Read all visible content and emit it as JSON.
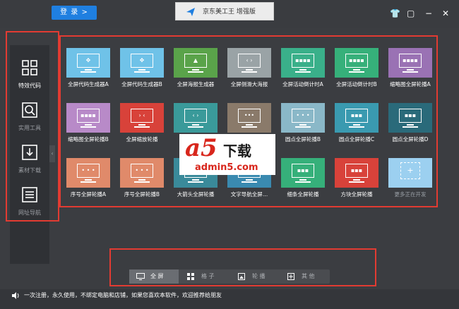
{
  "header": {
    "login_label": "登 录 >",
    "app_title": "京东美工王 增强版",
    "controls": {
      "shirt": "👕",
      "maximize": "▢",
      "minimize": "−",
      "close": "✕"
    },
    "brand_color": "#1f7fe0"
  },
  "sidebar": {
    "collapse_glyph": "‹",
    "items": [
      {
        "label": "特效代码",
        "icon": "grid-icon"
      },
      {
        "label": "实用工具",
        "icon": "search-icon"
      },
      {
        "label": "素材下载",
        "icon": "download-icon"
      },
      {
        "label": "网址导航",
        "icon": "list-icon"
      }
    ]
  },
  "tiles": [
    {
      "label": "全屏代码生成器A",
      "color": "#6fc2e8",
      "glyph": "✥"
    },
    {
      "label": "全屏代码生成器B",
      "color": "#6fc2e8",
      "glyph": "✥"
    },
    {
      "label": "全屏海报生成器",
      "color": "#5aa34a",
      "glyph": "▲"
    },
    {
      "label": "全屏侧滑大海报",
      "color": "#9aa3a6",
      "glyph": "‹ ›"
    },
    {
      "label": "全屏活动倒计时A",
      "color": "#3ab08a",
      "glyph": "▪▪▪▪"
    },
    {
      "label": "全屏活动倒计时B",
      "color": "#36b07a",
      "glyph": "▪▪▪▪"
    },
    {
      "label": "缩略图全屏轮播A",
      "color": "#9a72b4",
      "glyph": "▪▪▪▪"
    },
    {
      "label": "缩略图全屏轮播B",
      "color": "#b88ac8",
      "glyph": "▪▪▪▪"
    },
    {
      "label": "全屏缩放轮播",
      "color": "#d8423a",
      "glyph": "› ‹"
    },
    {
      "label": "普通全屏轮播",
      "color": "#3a9a9a",
      "glyph": "‹ ›"
    },
    {
      "label": "大图全屏轮播",
      "color": "#8a7a6a",
      "glyph": "•••"
    },
    {
      "label": "圆点全屏轮播B",
      "color": "#8ab8c8",
      "glyph": "• • •"
    },
    {
      "label": "圆点全屏轮播C",
      "color": "#3a9ab0",
      "glyph": "▪▪▪"
    },
    {
      "label": "圆点全屏轮播D",
      "color": "#2a6a7a",
      "glyph": "▪▪▪"
    },
    {
      "label": "序号全屏轮播A",
      "color": "#e08a6a",
      "glyph": "• • •"
    },
    {
      "label": "序号全屏轮播B",
      "color": "#e08a6a",
      "glyph": "• • •"
    },
    {
      "label": "大箭头全屏轮播",
      "color": "#3a8a9a",
      "glyph": "‹ ›"
    },
    {
      "label": "文字导航全屏…",
      "color": "#3a8ab0",
      "glyph": "▪▪▪"
    },
    {
      "label": "细条全屏轮播",
      "color": "#36b07a",
      "glyph": "▪▪▪"
    },
    {
      "label": "方块全屏轮播",
      "color": "#d8423a",
      "glyph": "▪▪▪"
    },
    {
      "label": "更多正在开发",
      "color": "#9cd0f0",
      "glyph": "+"
    }
  ],
  "tabs": [
    {
      "label": "全 屏",
      "icon": "monitor-icon"
    },
    {
      "label": "格 子",
      "icon": "grid-icon"
    },
    {
      "label": "轮 播",
      "icon": "image-icon"
    },
    {
      "label": "其 他",
      "icon": "move-icon"
    }
  ],
  "status": {
    "text": "一次注册，永久使用，不绑定电脑和店铺，如果您喜欢本软件，欢迎推荐给朋友"
  },
  "watermark": {
    "brand": "a5",
    "download": "下载",
    "url": "admin5.com"
  }
}
